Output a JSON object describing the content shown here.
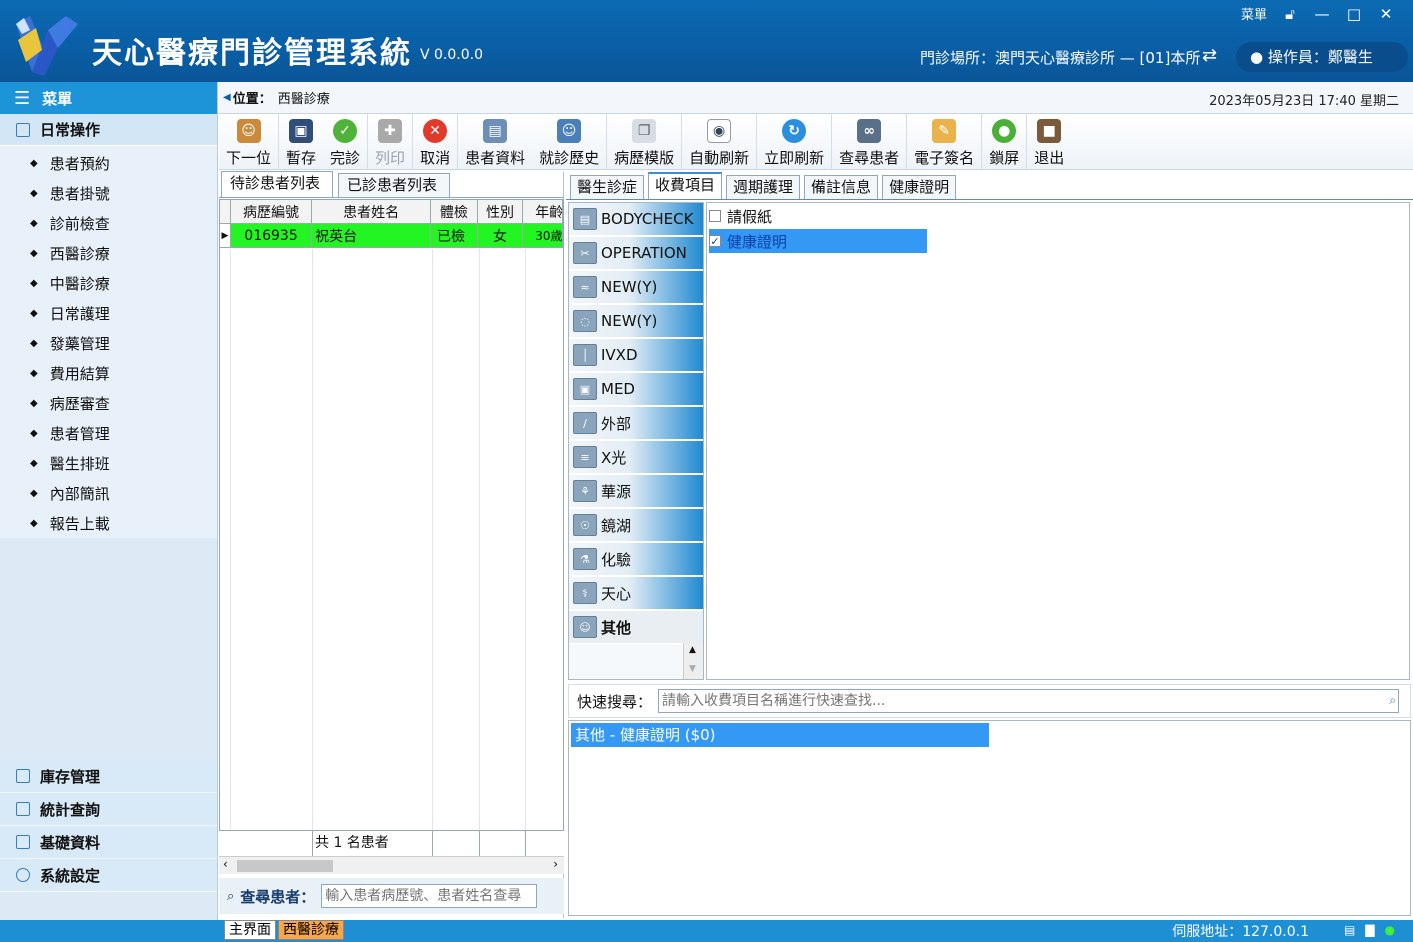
{
  "window": {
    "title": "天心醫療門診管理系統",
    "version": "V 0.0.0.0",
    "top_links": [
      "菜單"
    ],
    "site": "門診場所：澳門天心醫療診所 — [01]本所",
    "operator": "操作員：鄭醫生"
  },
  "sidebar": {
    "menu_label": "菜單",
    "daily_group": "日常操作",
    "items": [
      {
        "label": "患者預約"
      },
      {
        "label": "患者掛號"
      },
      {
        "label": "診前檢查"
      },
      {
        "label": "西醫診療"
      },
      {
        "label": "中醫診療"
      },
      {
        "label": "日常護理"
      },
      {
        "label": "發藥管理"
      },
      {
        "label": "費用結算"
      },
      {
        "label": "病歷審查"
      },
      {
        "label": "患者管理"
      },
      {
        "label": "醫生排班"
      },
      {
        "label": "內部簡訊"
      },
      {
        "label": "報告上載"
      }
    ],
    "bottom_groups": [
      {
        "label": "庫存管理"
      },
      {
        "label": "統計查詢"
      },
      {
        "label": "基礎資料"
      },
      {
        "label": "系統設定"
      }
    ]
  },
  "breadcrumb": {
    "label": "位置：",
    "value": "西醫診療",
    "datetime": "2023年05月23日 17:40  星期二"
  },
  "toolbar": {
    "buttons": [
      {
        "label": "下一位",
        "icon": "next-patient-icon"
      },
      {
        "label": "暫存",
        "icon": "save-icon"
      },
      {
        "label": "完診",
        "icon": "check-icon"
      },
      {
        "label": "列印",
        "icon": "print-icon"
      },
      {
        "label": "取消",
        "icon": "cancel-icon"
      },
      {
        "label": "患者資料",
        "icon": "patient-card-icon"
      },
      {
        "label": "就診歷史",
        "icon": "history-icon"
      },
      {
        "label": "病歷模版",
        "icon": "template-icon"
      },
      {
        "label": "自動刷新",
        "icon": "eye-icon"
      },
      {
        "label": "立即刷新",
        "icon": "refresh-icon"
      },
      {
        "label": "查尋患者",
        "icon": "binoculars-icon"
      },
      {
        "label": "電子簽名",
        "icon": "signature-icon"
      },
      {
        "label": "鎖屏",
        "icon": "lock-icon"
      },
      {
        "label": "退出",
        "icon": "exit-icon"
      }
    ]
  },
  "patients": {
    "tabs": [
      "待診患者列表",
      "已診患者列表"
    ],
    "columns": [
      "病歷編號",
      "患者姓名",
      "體檢",
      "性別",
      "年齡"
    ],
    "rows": [
      {
        "id": "016935",
        "name": "祝英台",
        "checkup": "已檢",
        "gender": "女",
        "age": "30歲"
      }
    ],
    "footer_count": "共 1 名患者",
    "search_label": "查尋患者：",
    "search_placeholder": "輸入患者病歷號、患者姓名查尋"
  },
  "detail": {
    "tabs": [
      "醫生診症",
      "收費項目",
      "週期護理",
      "備註信息",
      "健康證明"
    ],
    "categories": [
      {
        "label": "BODYCHECK"
      },
      {
        "label": "OPERATION"
      },
      {
        "label": "NEW(Y)"
      },
      {
        "label": "NEW(Y)"
      },
      {
        "label": "IVXD"
      },
      {
        "label": "MED"
      },
      {
        "label": "外部"
      },
      {
        "label": "X光"
      },
      {
        "label": "華源"
      },
      {
        "label": "鏡湖"
      },
      {
        "label": "化驗"
      },
      {
        "label": "天心"
      },
      {
        "label": "其他"
      }
    ],
    "fee_items": [
      {
        "label": "請假紙",
        "checked": false
      },
      {
        "label": "健康證明",
        "checked": true
      }
    ],
    "quick_search_label": "快速搜尋：",
    "quick_search_placeholder": "請輸入收費項目名稱進行快速查找...",
    "selected_result": "其他 - 健康證明 ($0)"
  },
  "status": {
    "tabs": [
      "主界面",
      "西醫診療"
    ],
    "server": "伺服地址：127.0.0.1"
  }
}
